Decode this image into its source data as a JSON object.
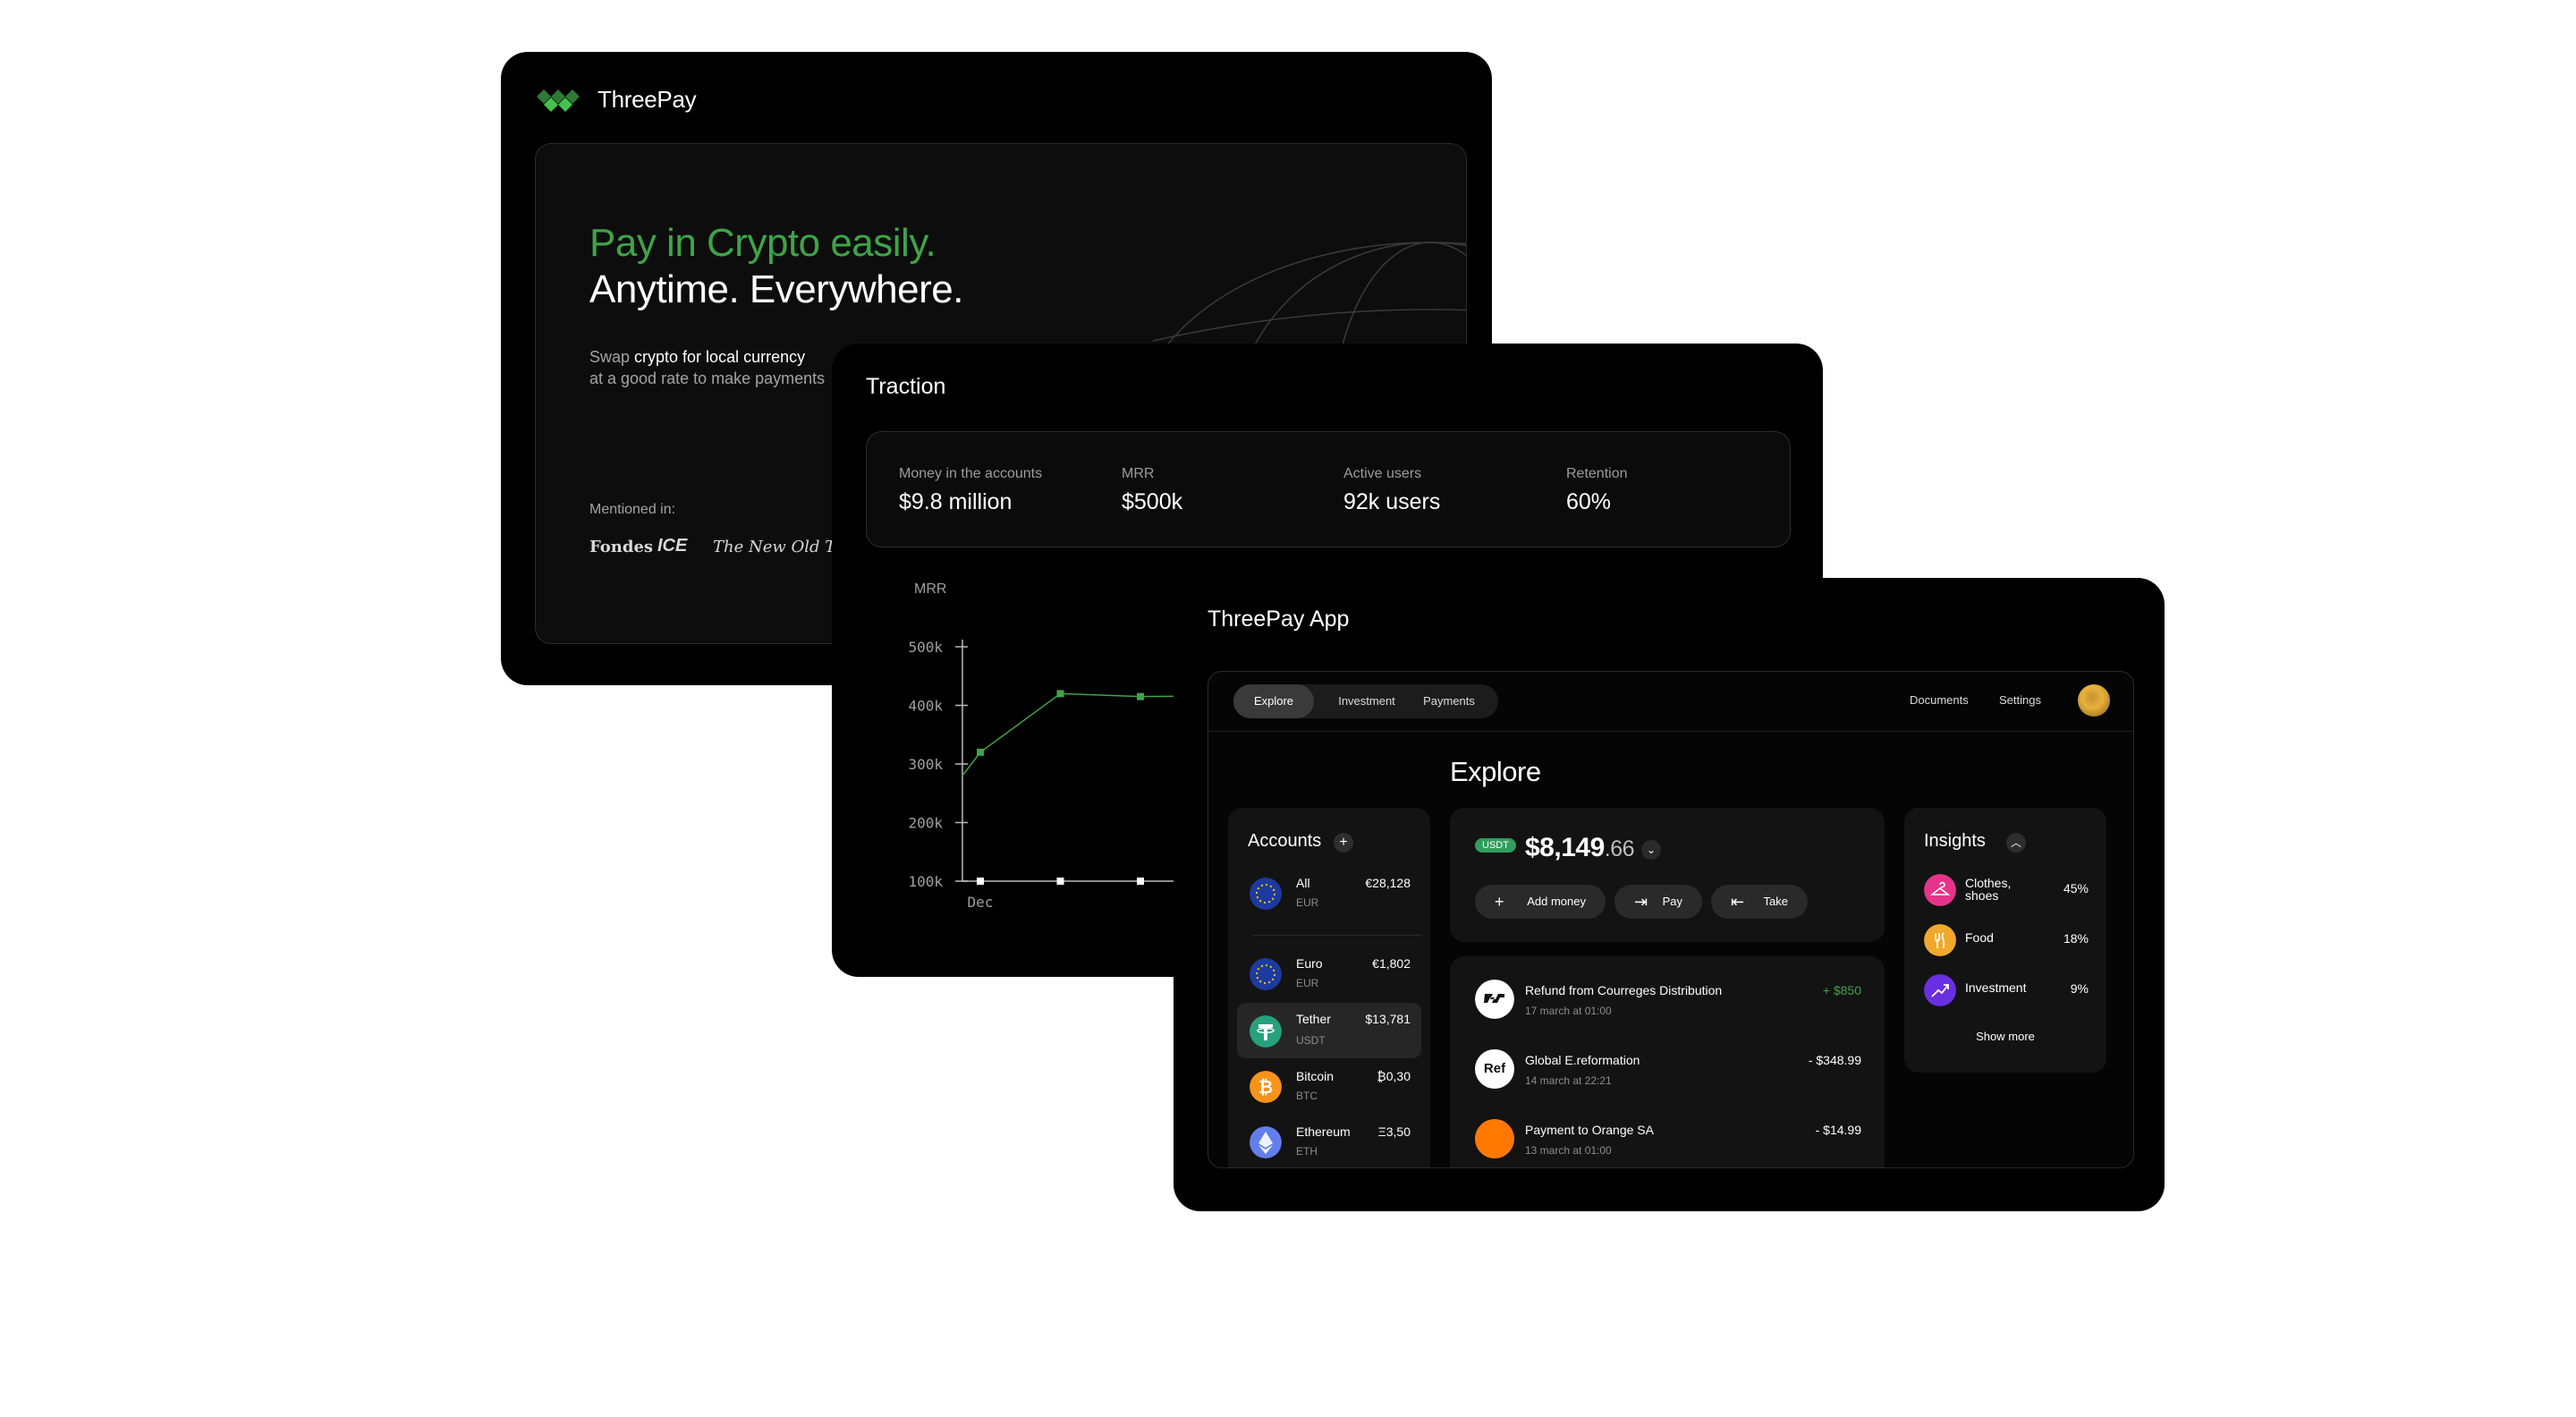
{
  "slide1": {
    "brand": "ThreePay",
    "headline_green": "Pay in Crypto easily.",
    "headline_white": "Anytime. Everywhere.",
    "sub_line1_a": "Swap ",
    "sub_line1_b": "crypto for local currency",
    "sub_line2": "at a good rate to make payments",
    "mentioned": "Mentioned in:",
    "press": [
      "Fondes",
      "ICE",
      "The New Old Times"
    ],
    "colors": {
      "accent": "#3ea447"
    }
  },
  "slide2": {
    "title": "Traction",
    "stats": [
      {
        "label": "Money in the accounts",
        "value": "$9.8 million"
      },
      {
        "label": "MRR",
        "value": "$500k"
      },
      {
        "label": "Active users",
        "value": "92k  users"
      },
      {
        "label": "Retention",
        "value": "60%"
      }
    ],
    "chart_label": "MRR"
  },
  "chart_data": {
    "type": "line",
    "title": "MRR",
    "x_labels": [
      "Dec"
    ],
    "y_ticks": [
      "500k",
      "400k",
      "300k",
      "200k",
      "100k"
    ],
    "ylim": [
      100000,
      500000
    ],
    "series": [
      {
        "color": "#3ea447",
        "values": [
          280000,
          320000,
          420000,
          415000
        ]
      },
      {
        "color": "#ffffff",
        "values": [
          100000,
          100000,
          100000
        ]
      }
    ]
  },
  "slide3": {
    "title": "ThreePay App",
    "tabs": [
      "Explore",
      "Investment",
      "Payments"
    ],
    "links": [
      "Documents",
      "Settings"
    ],
    "page_title": "Explore",
    "accounts_title": "Accounts",
    "accounts": [
      {
        "name": "All",
        "currency": "EUR",
        "amount": "€28,128",
        "icon": "eu-flag-icon"
      },
      {
        "name": "Euro",
        "currency": "EUR",
        "amount": "€1,802",
        "icon": "eu-flag-icon"
      },
      {
        "name": "Tether",
        "currency": "USDT",
        "amount": "$13,781",
        "icon": "tether-icon"
      },
      {
        "name": "Bitcoin",
        "currency": "BTC",
        "amount": "₿0,30",
        "icon": "bitcoin-icon"
      },
      {
        "name": "Ethereum",
        "currency": "ETH",
        "amount": "Ξ3,50",
        "icon": "ethereum-icon"
      }
    ],
    "balance": {
      "badge": "USDT",
      "whole": "$8,149",
      "cents": ".66"
    },
    "actions": [
      {
        "label": "Add money",
        "glyph": "+"
      },
      {
        "label": "Pay",
        "glyph": "⇥"
      },
      {
        "label": "Take",
        "glyph": "⇤"
      }
    ],
    "transactions": [
      {
        "name": "Refund from Courreges Distribution",
        "date": "17 march at 01:00",
        "amount": "+ $850",
        "icon_text": ""
      },
      {
        "name": "Global E.reformation",
        "date": "14 march at 22:21",
        "amount": "- $348.99",
        "icon_text": "Ref"
      },
      {
        "name": "Payment to Orange SA",
        "date": "13 march at 01:00",
        "amount": "- $14.99",
        "icon_text": ""
      }
    ],
    "insights_title": "Insights",
    "insights": [
      {
        "name": "Clothes, shoes",
        "pct": "45%",
        "color": "#e6348b"
      },
      {
        "name": "Food",
        "pct": "18%",
        "color": "#f0a92a"
      },
      {
        "name": "Investment",
        "pct": "9%",
        "color": "#6b2fe3"
      }
    ],
    "show_more": "Show more"
  }
}
